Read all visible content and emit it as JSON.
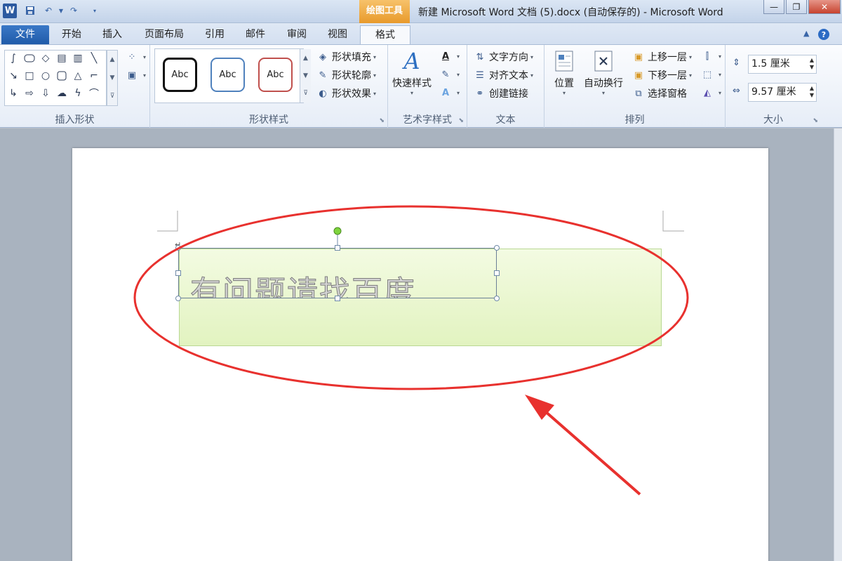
{
  "titlebar": {
    "logo": "W",
    "context_tab": "绘图工具",
    "doc_title": "新建 Microsoft Word 文档 (5).docx (自动保存的)  -  Microsoft Word",
    "quick_access": [
      "save-icon",
      "undo-icon",
      "redo-icon",
      "customize-icon"
    ],
    "minimize": "—",
    "restore": "❐",
    "close": "✕"
  },
  "tabs": {
    "file": "文件",
    "items": [
      "开始",
      "插入",
      "页面布局",
      "引用",
      "邮件",
      "审阅",
      "视图"
    ],
    "format": "格式",
    "help": "?"
  },
  "ribbon": {
    "insert_shapes": {
      "label": "插入形状"
    },
    "shape_styles": {
      "label": "形状样式",
      "preview_text": "Abc",
      "fill": "形状填充",
      "outline": "形状轮廓",
      "effect": "形状效果"
    },
    "wordart": {
      "label": "艺术字样式",
      "quick": "快速样式"
    },
    "text": {
      "label": "文本",
      "direction": "文字方向",
      "align": "对齐文本",
      "link": "创建链接"
    },
    "arrange": {
      "label": "排列",
      "position": "位置",
      "wrap": "自动换行",
      "forward": "上移一层",
      "backward": "下移一层",
      "pane": "选择窗格"
    },
    "size": {
      "label": "大小",
      "height": "1.5 厘米",
      "width": "9.57 厘米"
    }
  },
  "document": {
    "wordart_text": "有问题请找百度"
  },
  "colors": {
    "annotation": "#e8312e",
    "context_tab": "#f0a83c",
    "file_tab": "#2a67b8"
  }
}
